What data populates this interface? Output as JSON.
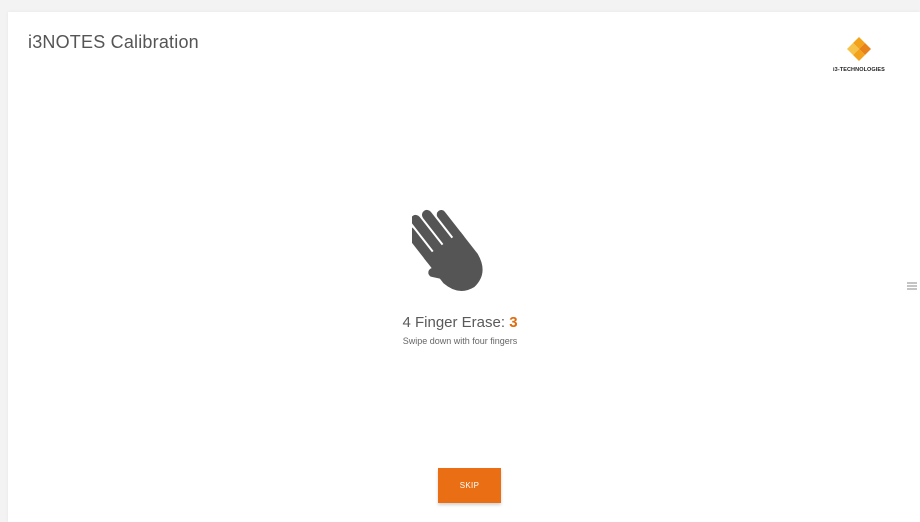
{
  "header": {
    "title": "i3NOTES Calibration",
    "logo_text": "i3-TECHNOLOGIES"
  },
  "gesture": {
    "icon": "hand-icon",
    "title": "4 Finger Erase:",
    "count": "3",
    "hint": "Swipe down with four fingers"
  },
  "actions": {
    "skip_label": "SKIP"
  },
  "side_menu": {
    "icon": "menu-icon"
  },
  "colors": {
    "accent": "#ea6f14",
    "count": "#e06c0e",
    "icon_gray": "#555555",
    "text": "#555555"
  }
}
